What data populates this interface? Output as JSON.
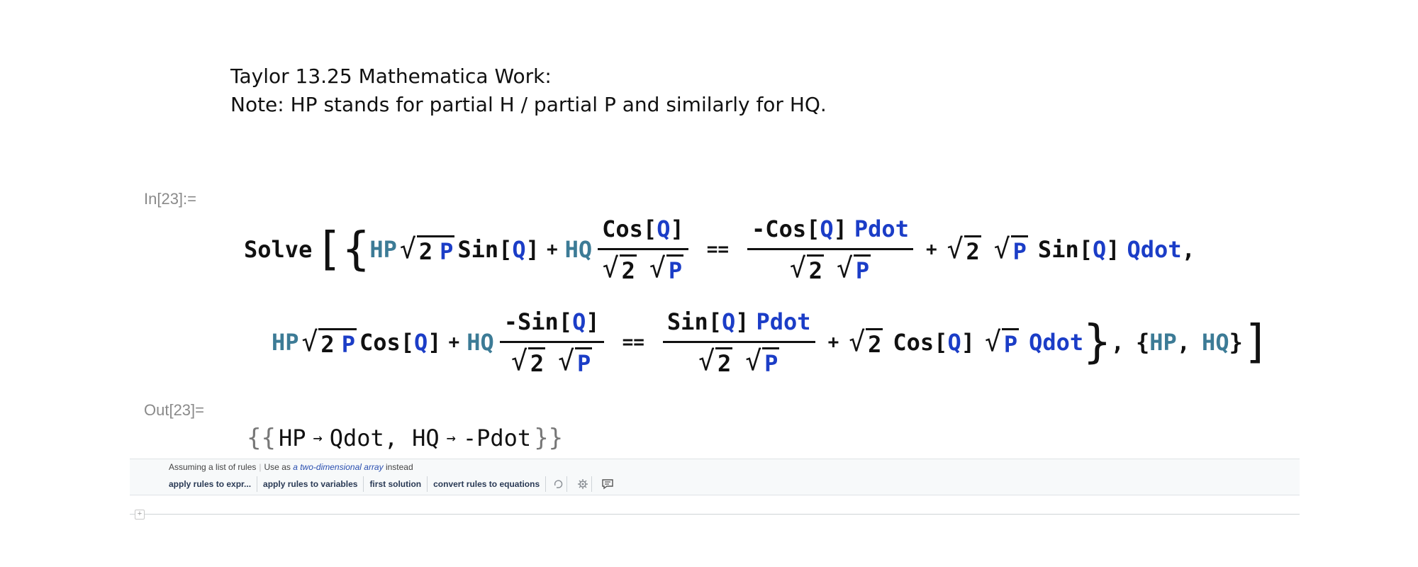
{
  "notebook": {
    "text_cell": {
      "line1": "Taylor 13.25 Mathematica Work:",
      "line2": "Note: HP stands for partial H / partial P and similarly for HQ."
    },
    "input_label": "In[23]:=",
    "output_label": "Out[23]=",
    "output_rules": [
      {
        "lhs": "HP",
        "rhs": "Qdot"
      },
      {
        "lhs": "HQ",
        "rhs": "-Pdot"
      }
    ],
    "colors": {
      "system_symbol": "#111111",
      "defined_var": "#3c7b96",
      "undefined_var": "#1b3dc7",
      "label_gray": "#8a8a8a"
    }
  },
  "code": {
    "solve": "Solve",
    "hp": "HP",
    "hq": "HQ",
    "p": "P",
    "q": "Q",
    "pdot": "Pdot",
    "qdot": "Qdot",
    "two": "2",
    "sin": "Sin",
    "cos": "Cos",
    "minus_cos": "-Cos",
    "minus_sin": "-Sin"
  },
  "assistant": {
    "assume_text": "Assuming a list of rules",
    "use_as": "Use as",
    "alt_link": "a two-dimensional array",
    "instead": "instead",
    "buttons": [
      "apply rules to expr...",
      "apply rules to variables",
      "first solution",
      "convert rules to equations"
    ],
    "icons": [
      "undo-icon",
      "settings-icon",
      "feedback-icon"
    ]
  }
}
